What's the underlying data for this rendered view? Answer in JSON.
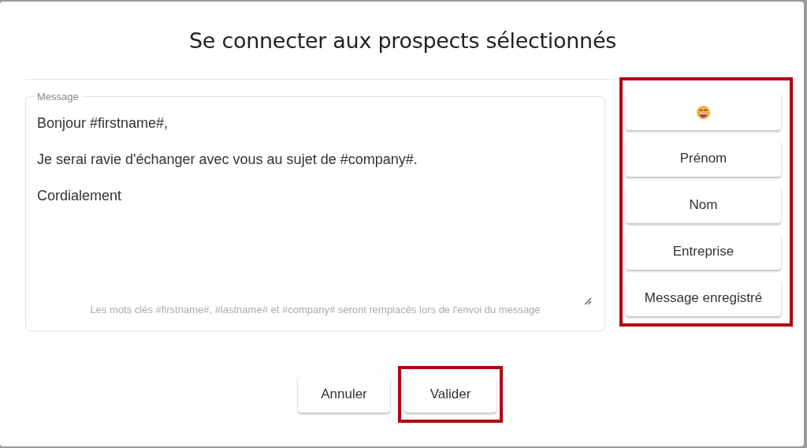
{
  "dialog": {
    "title": "Se connecter aux prospects sélectionnés"
  },
  "message": {
    "label": "Message",
    "paragraphs": [
      "Bonjour #firstname#,",
      "Je serai ravie d'échanger avec vous au sujet de #company#.",
      "Cordialement"
    ],
    "helper": "Les mots clés #firstname#, #lastname# et #company# seront remplacés lors de l'envoi du message"
  },
  "side_panel": {
    "highlighted": true,
    "buttons": [
      {
        "kind": "emoji"
      },
      {
        "kind": "text",
        "label": "Prénom"
      },
      {
        "kind": "text",
        "label": "Nom"
      },
      {
        "kind": "text",
        "label": "Entreprise"
      },
      {
        "kind": "text",
        "label": "Message enregistré"
      }
    ]
  },
  "actions": [
    {
      "label": "Annuler",
      "highlighted": false
    },
    {
      "label": "Valider",
      "highlighted": true
    }
  ]
}
